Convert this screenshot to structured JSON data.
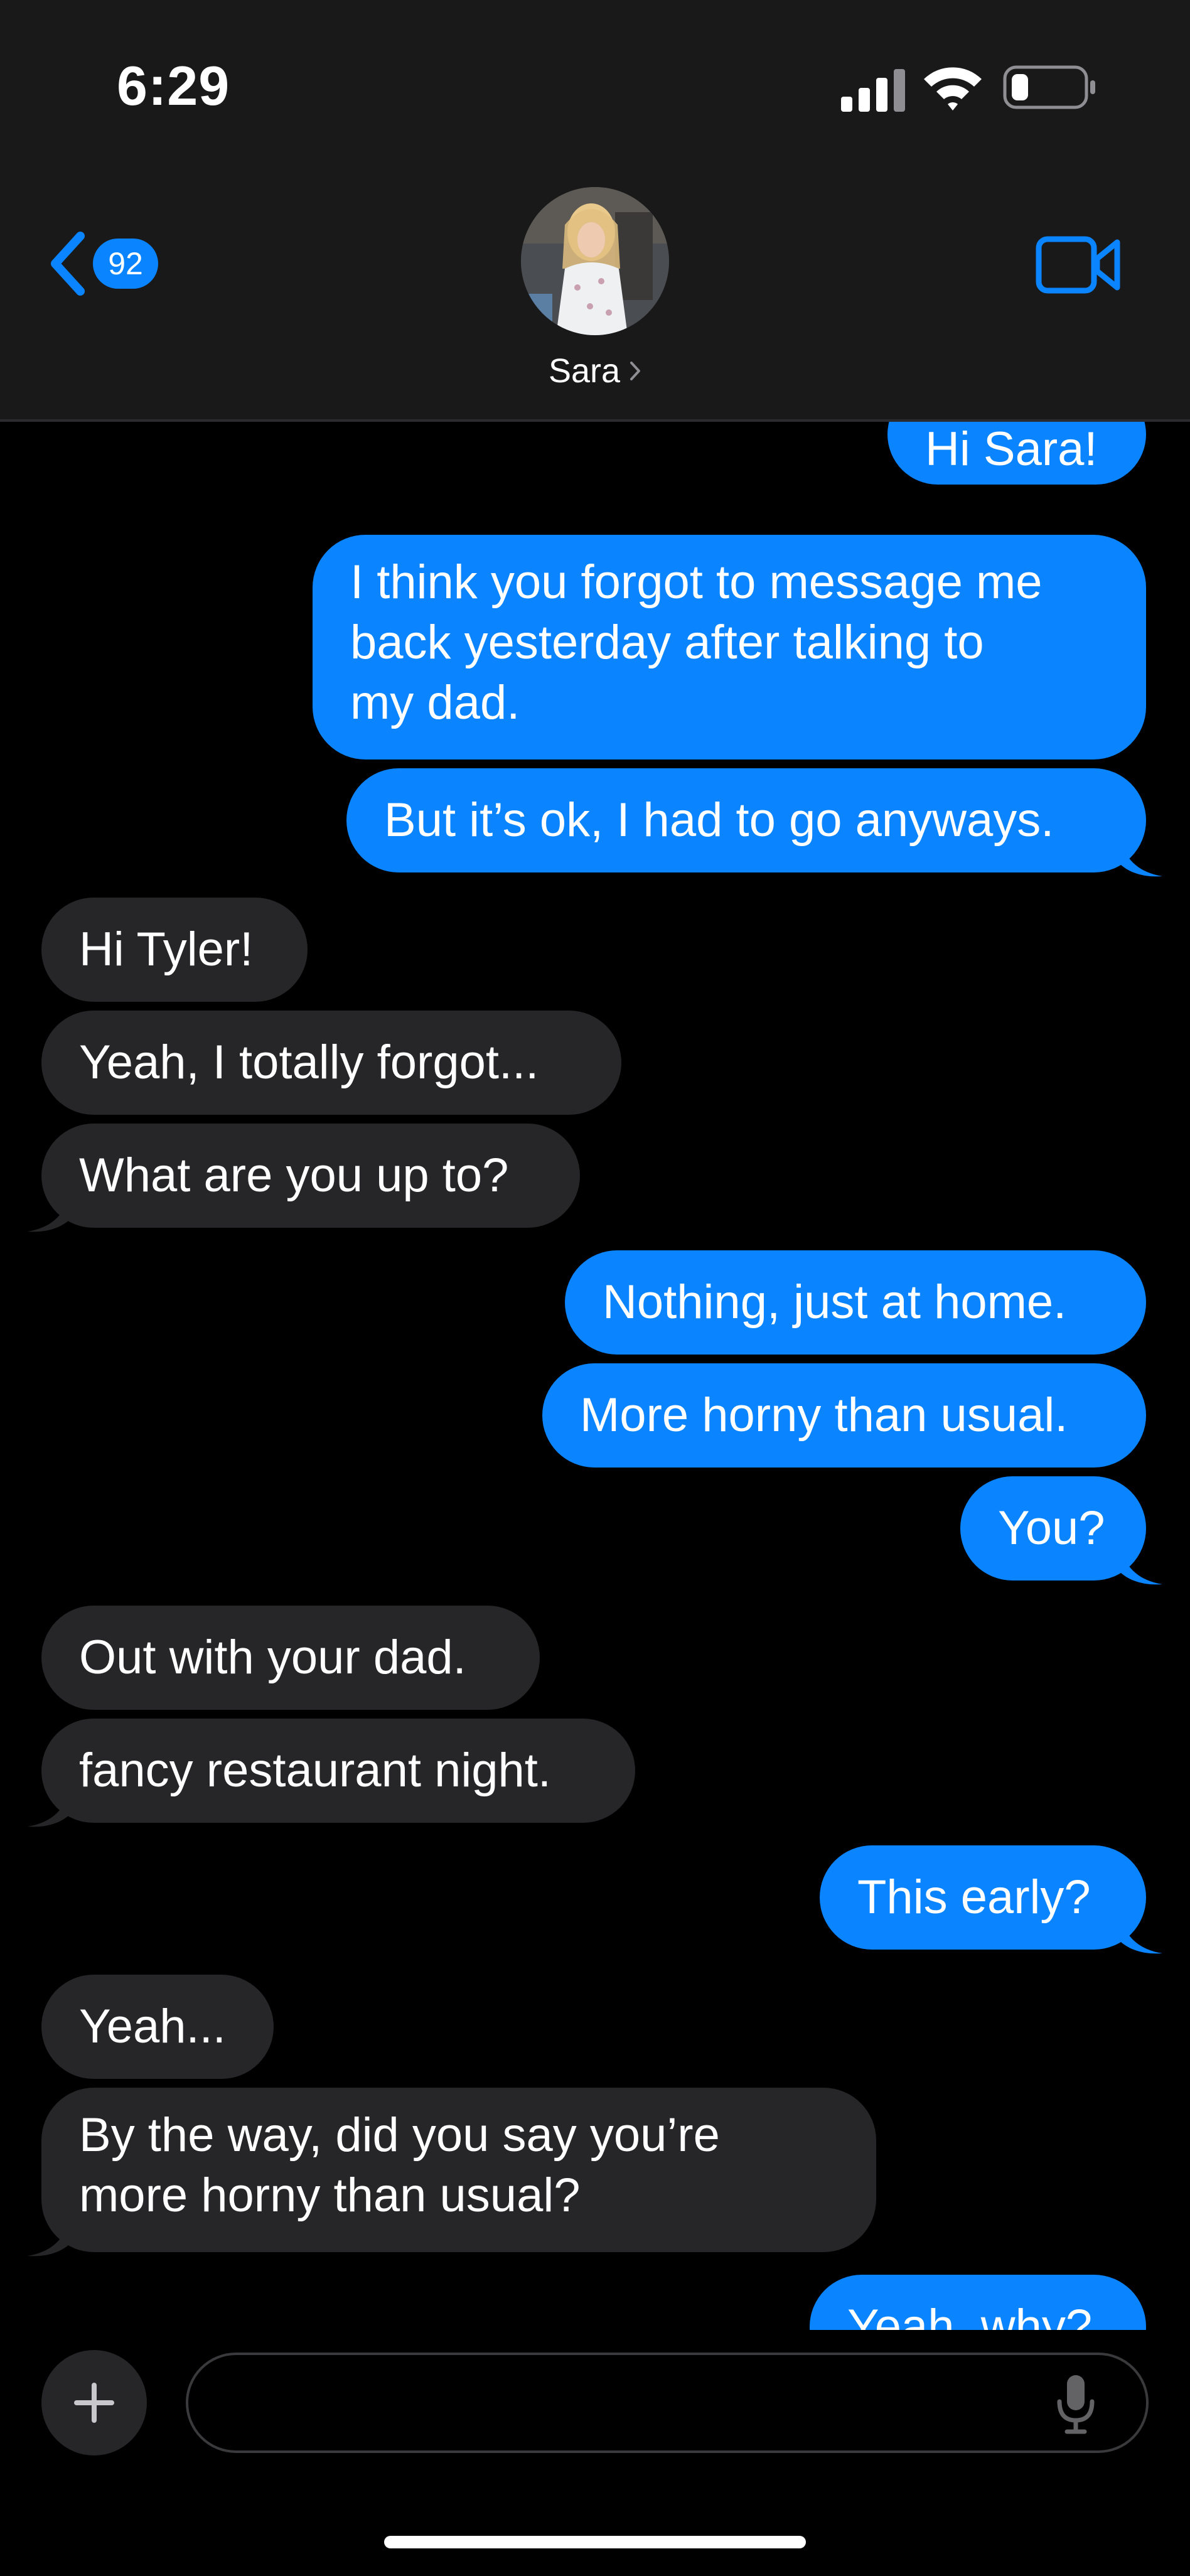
{
  "status_bar": {
    "time": "6:29",
    "signal_icon": "cellular-signal-icon",
    "wifi_icon": "wifi-icon",
    "battery_icon": "battery-low-icon"
  },
  "header": {
    "back_badge": "92",
    "contact_name": "Sara",
    "avatar_icon": "contact-avatar-photo",
    "video_icon": "video-camera-icon"
  },
  "colors": {
    "outgoing_bubble": "#0a84ff",
    "incoming_bubble": "#262628",
    "header_background": "#191919",
    "accent": "#0a84ff"
  },
  "messages": [
    {
      "direction": "outgoing",
      "text": "Hi Sara!"
    },
    {
      "direction": "outgoing",
      "text": "I think you forgot to message me\nback yesterday after talking to\nmy dad."
    },
    {
      "direction": "outgoing",
      "text": "But it’s ok, I had to go anyways."
    },
    {
      "direction": "incoming",
      "text": "Hi Tyler!"
    },
    {
      "direction": "incoming",
      "text": "Yeah, I totally forgot..."
    },
    {
      "direction": "incoming",
      "text": "What are you up to?"
    },
    {
      "direction": "outgoing",
      "text": "Nothing, just at home."
    },
    {
      "direction": "outgoing",
      "text": "More horny than usual."
    },
    {
      "direction": "outgoing",
      "text": "You?"
    },
    {
      "direction": "incoming",
      "text": "Out with your dad."
    },
    {
      "direction": "incoming",
      "text": "fancy restaurant night."
    },
    {
      "direction": "outgoing",
      "text": "This early?"
    },
    {
      "direction": "incoming",
      "text": "Yeah..."
    },
    {
      "direction": "incoming",
      "text": "By the way, did you say you’re\nmore horny than usual?"
    },
    {
      "direction": "outgoing",
      "text": "Yeah, why?"
    }
  ],
  "composer": {
    "plus_icon": "plus-icon",
    "message_value": "",
    "mic_icon": "microphone-icon"
  }
}
